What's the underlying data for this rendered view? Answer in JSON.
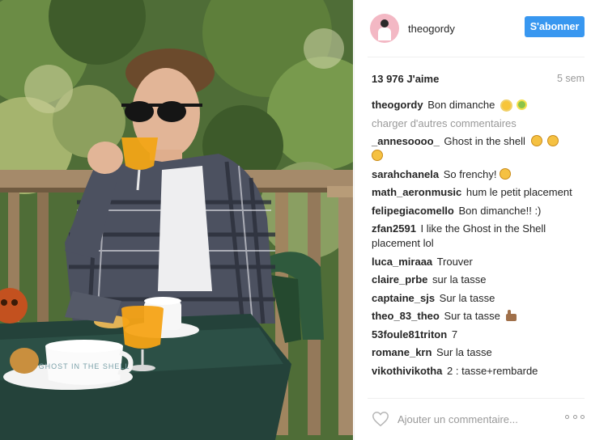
{
  "photo": {
    "mug_text": "GHOST IN THE SHELL"
  },
  "post": {
    "username": "theogordy",
    "follow_label": "S'abonner",
    "likes": "13 976 J'aime",
    "age": "5 sem",
    "load_more": "charger d'autres commentaires",
    "add_comment_placeholder": "Ajouter un commentaire...",
    "caption": {
      "user": "theogordy",
      "text": "Bon dimanche"
    },
    "comments": [
      {
        "user": "_annesoooo_",
        "text": "Ghost in the shell"
      },
      {
        "user": "sarahchanela",
        "text": "So frenchy!"
      },
      {
        "user": "math_aeronmusic",
        "text": "hum le petit placement"
      },
      {
        "user": "felipegiacomello",
        "text": "Bon dimanche!! :)"
      },
      {
        "user": "zfan2591",
        "text": "I like the Ghost in the Shell placement lol"
      },
      {
        "user": "luca_miraaa",
        "text": "Trouver"
      },
      {
        "user": "claire_prbe",
        "text": "sur la tasse"
      },
      {
        "user": "captaine_sjs",
        "text": "Sur la tasse"
      },
      {
        "user": "theo_83_theo",
        "text": "Sur ta tasse"
      },
      {
        "user": "53foule81triton",
        "text": "7"
      },
      {
        "user": "romane_krn",
        "text": "Sur la tasse"
      },
      {
        "user": "vikothivikotha",
        "text": "2 : tasse+rembarde"
      }
    ]
  },
  "colors": {
    "accent": "#3897f0",
    "muted": "#999999",
    "text": "#262626"
  }
}
